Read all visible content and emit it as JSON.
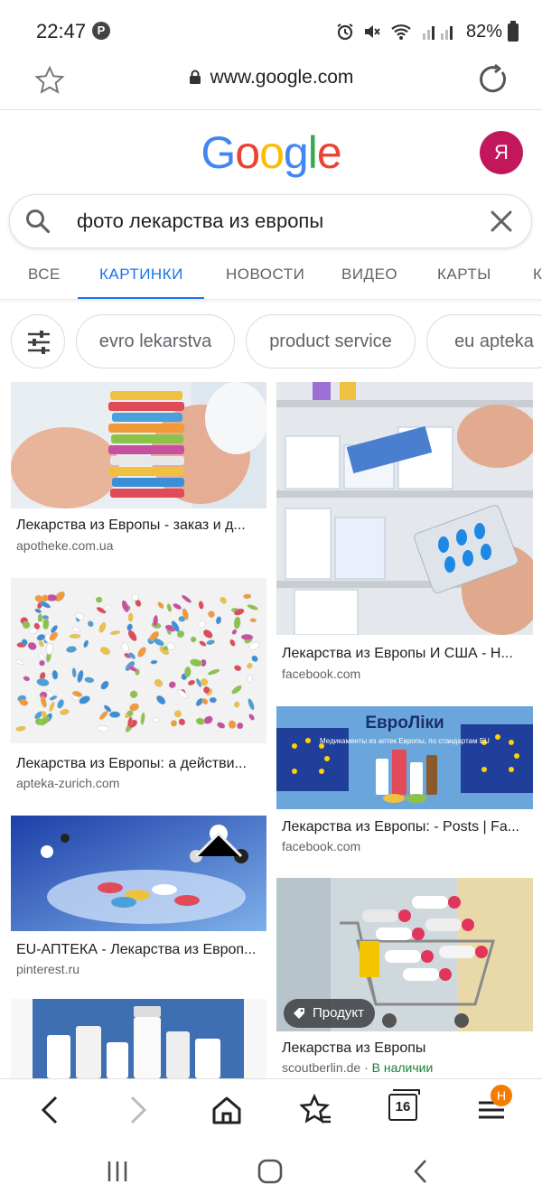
{
  "status_bar": {
    "time": "22:47",
    "battery": "82%",
    "icons": [
      "pinterest-icon",
      "alarm-icon",
      "mute-icon",
      "wifi-icon",
      "signal-icon",
      "battery-icon"
    ]
  },
  "browser": {
    "url": "www.google.com",
    "icons": [
      "star-icon",
      "lock-icon",
      "reload-icon"
    ]
  },
  "header": {
    "logo_letters": [
      "G",
      "o",
      "o",
      "g",
      "l",
      "e"
    ],
    "logo_colors": [
      "#4285F4",
      "#EA4335",
      "#FBBC05",
      "#4285F4",
      "#34A853",
      "#EA4335"
    ],
    "avatar_letter": "Я",
    "avatar_color": "#c2185b"
  },
  "search": {
    "query": "фото лекарства из европы"
  },
  "tabs": [
    {
      "label": "ВСЕ",
      "active": false
    },
    {
      "label": "КАРТИНКИ",
      "active": true
    },
    {
      "label": "НОВОСТИ",
      "active": false
    },
    {
      "label": "ВИДЕО",
      "active": false
    },
    {
      "label": "КАРТЫ",
      "active": false
    },
    {
      "label": "К",
      "active": false
    }
  ],
  "chips": [
    "evro lekarstva",
    "product service",
    "eu apteka"
  ],
  "results": {
    "left": [
      {
        "title": "Лекарства из Европы - заказ и д...",
        "source": "apotheke.com.ua"
      },
      {
        "title": "Лекарства из Европы: а действи...",
        "source": "apteka-zurich.com"
      },
      {
        "title": "EU-АПТЕКА - Лекарства из Европ...",
        "source": "pinterest.ru"
      }
    ],
    "right": [
      {
        "title": "Лекарства из Европы И США - Н...",
        "source": "facebook.com"
      },
      {
        "title": "Лекарства из Европы: - Posts | Fa...",
        "source": "facebook.com",
        "banner_title": "ЕвроЛіки",
        "banner_subtitle": "Медикаменты из аптек Европы, по стандартам EU"
      },
      {
        "title": "Лекарства из Европы",
        "source": "scoutberlin.de",
        "stock": "· В наличии",
        "badge": "Продукт"
      }
    ]
  },
  "bottom_bar": {
    "tabs_count": "16",
    "notification": "Н",
    "icons": [
      "back-icon",
      "forward-icon",
      "home-icon",
      "bookmarks-icon",
      "tabs-icon",
      "menu-icon"
    ]
  },
  "system_nav": [
    "recents-icon",
    "home-circle-icon",
    "system-back-icon"
  ]
}
